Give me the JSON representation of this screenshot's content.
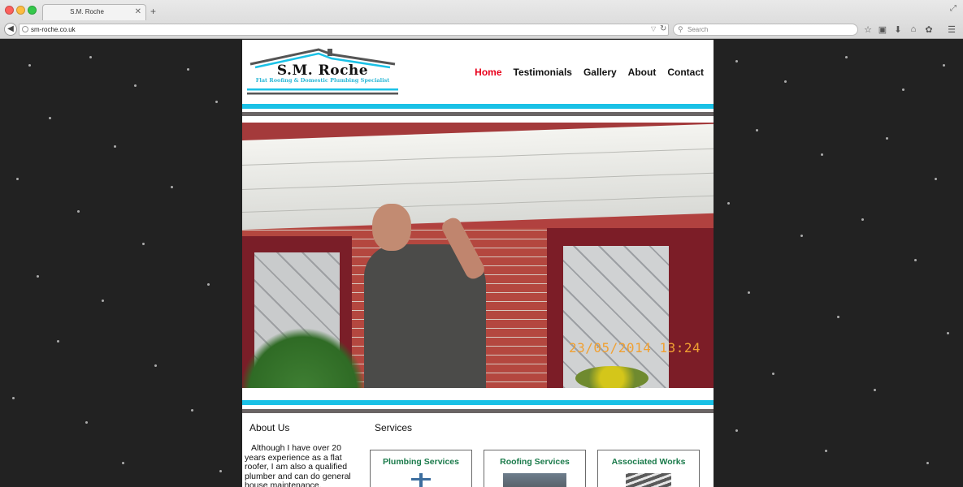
{
  "browser": {
    "tab_title": "S.M. Roche",
    "tab_close": "✕",
    "new_tab": "+",
    "url": "sm-roche.co.uk",
    "search_placeholder": "Search"
  },
  "site": {
    "logo_title": "S.M. Roche",
    "logo_subtitle": "Flat Roofing & Domestic Plumbing Specialist",
    "nav": [
      "Home",
      "Testimonials",
      "Gallery",
      "About",
      "Contact"
    ],
    "active_nav": "Home",
    "photo_timestamp": "23/05/2014 13:24",
    "about": {
      "title": "About Us",
      "text": "Although I have over 20 years experience as a flat roofer, I am also a qualified plumber and can do general house maintenance."
    },
    "services": {
      "title": "Services",
      "items": [
        "Plumbing Services",
        "Roofing Services",
        "Associated Works"
      ]
    }
  },
  "colors": {
    "accent_blue": "#1ac1e6",
    "stripe_grey": "#6a6464",
    "active_nav": "#e8001c",
    "service_label": "#1a7a4a"
  }
}
